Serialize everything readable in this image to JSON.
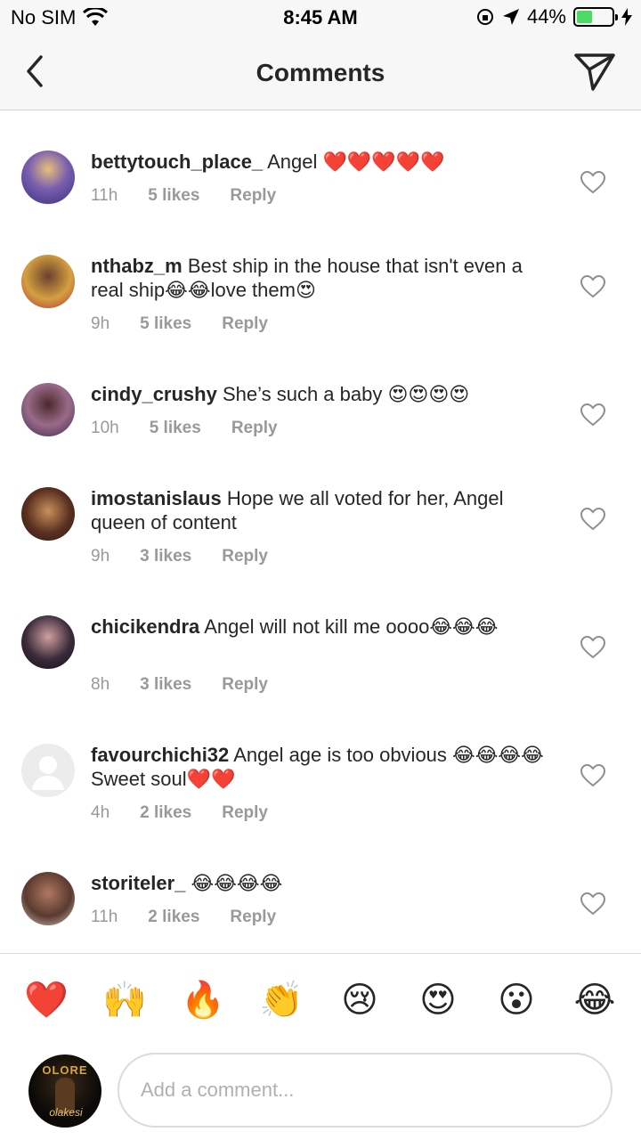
{
  "status_bar": {
    "carrier": "No SIM",
    "time": "8:45 AM",
    "battery": "44%",
    "battery_level": 0.44
  },
  "header": {
    "title": "Comments"
  },
  "comments": [
    {
      "username": "bettytouch_place_",
      "text": "Angel ❤️❤️❤️❤️❤️",
      "time": "11h",
      "likes": "5 likes",
      "reply": "Reply"
    },
    {
      "username": "nthabz_m",
      "text": "Best ship in the house that isn't even a real ship😂😂love them😍",
      "time": "9h",
      "likes": "5 likes",
      "reply": "Reply"
    },
    {
      "username": "cindy_crushy",
      "text": "She’s such a baby 😍😍😍😍",
      "time": "10h",
      "likes": "5 likes",
      "reply": "Reply"
    },
    {
      "username": "imostanislaus",
      "text": "Hope we all voted for her, Angel queen of content",
      "time": "9h",
      "likes": "3 likes",
      "reply": "Reply"
    },
    {
      "username": "chicikendra",
      "text": "Angel will not kill me oooo😂😂😂",
      "time": "8h",
      "likes": "3 likes",
      "reply": "Reply"
    },
    {
      "username": "favourchichi32",
      "text": "Angel age is too obvious 😂😂😂😂Sweet soul❤️❤️",
      "time": "4h",
      "likes": "2 likes",
      "reply": "Reply"
    },
    {
      "username": "storiteler_",
      "text": "😂😂😂😂",
      "time": "11h",
      "likes": "2 likes",
      "reply": "Reply"
    }
  ],
  "reactions": [
    "❤️",
    "🙌",
    "🔥",
    "👏",
    "😢",
    "😍",
    "😮",
    "😂"
  ],
  "input": {
    "placeholder": "Add a comment...",
    "avatar_text": "OLORE",
    "avatar_signature": "olakesi"
  }
}
